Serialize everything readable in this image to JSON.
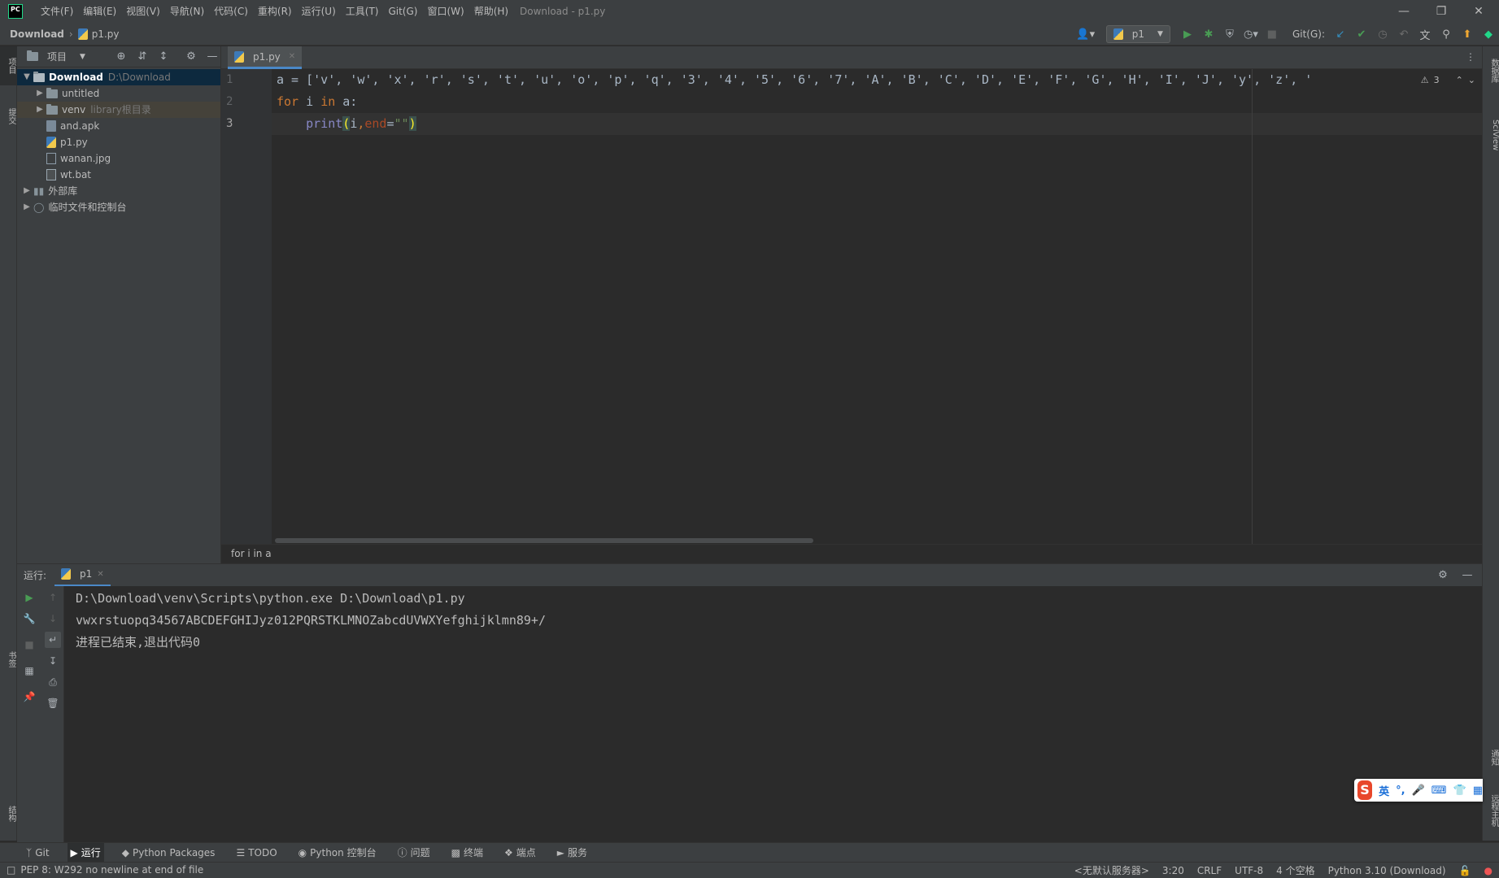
{
  "window": {
    "title": "Download - p1.py",
    "logo_text": "PC"
  },
  "menu": [
    "文件(F)",
    "编辑(E)",
    "视图(V)",
    "导航(N)",
    "代码(C)",
    "重构(R)",
    "运行(U)",
    "工具(T)",
    "Git(G)",
    "窗口(W)",
    "帮助(H)"
  ],
  "navbar": {
    "project": "Download",
    "file": "p1.py",
    "run_config": "p1",
    "git_label": "Git(G):"
  },
  "left_strip": {
    "tab_project": "项目",
    "tab_commit": "提交",
    "tab_bookmarks": "书签",
    "tab_structure": "结构"
  },
  "right_strip": {
    "tab_database": "数据库",
    "tab_sciview": "SciView",
    "tab_notifications": "通知",
    "tab_remote_host": "远程主机"
  },
  "project_panel": {
    "title": "项目",
    "root": {
      "name": "Download",
      "path": "D:\\Download"
    },
    "items": [
      {
        "name": "untitled",
        "type": "folder",
        "note": ""
      },
      {
        "name": "venv",
        "type": "folder",
        "note": "library根目录"
      },
      {
        "name": "and.apk",
        "type": "apk"
      },
      {
        "name": "p1.py",
        "type": "py"
      },
      {
        "name": "wanan.jpg",
        "type": "jpg"
      },
      {
        "name": "wt.bat",
        "type": "bat"
      }
    ],
    "external_libs": "外部库",
    "scratches": "临时文件和控制台"
  },
  "editor": {
    "tab": "p1.py",
    "line_numbers": [
      "1",
      "2",
      "3"
    ],
    "line1": "a = ['v', 'w', 'x', 'r', 's', 't', 'u', 'o', 'p', 'q', '3', '4', '5', '6', '7', 'A', 'B', 'C', 'D', 'E', 'F', 'G', 'H', 'I', 'J', 'y', 'z', '",
    "line2_kw_for": "for",
    "line2_mid": " i ",
    "line2_kw_in": "in",
    "line2_end": " a:",
    "line3_indent": "    ",
    "line3_func": "print",
    "line3_open": "(",
    "line3_arg": "i",
    "line3_comma": ",",
    "line3_param": "end",
    "line3_eq": "=",
    "line3_str": "\"\"",
    "line3_close": ")",
    "warning_count": "3",
    "breadcrumb": "for i in a"
  },
  "run_panel": {
    "label": "运行:",
    "tab": "p1",
    "console": [
      "D:\\Download\\venv\\Scripts\\python.exe D:\\Download\\p1.py",
      "vwxrstuopq34567ABCDEFGHIJyz012PQRSTKLMNOZabcdUVWXYefghijklmn89+/",
      "进程已结束,退出代码0"
    ]
  },
  "ime": {
    "logo": "S",
    "lang": "英"
  },
  "bottom_tabs": [
    "Git",
    "运行",
    "Python Packages",
    "TODO",
    "Python 控制台",
    "问题",
    "终端",
    "端点",
    "服务"
  ],
  "status": {
    "message": "PEP 8: W292 no newline at end of file",
    "interpreter_server": "<无默认服务器>",
    "position": "3:20",
    "line_sep": "CRLF",
    "encoding": "UTF-8",
    "indent": "4 个空格",
    "python": "Python 3.10 (Download)"
  },
  "colors": {
    "accent": "#4a88c7",
    "keyword": "#cc7832",
    "string": "#6a8759",
    "run_green": "#499c54"
  }
}
